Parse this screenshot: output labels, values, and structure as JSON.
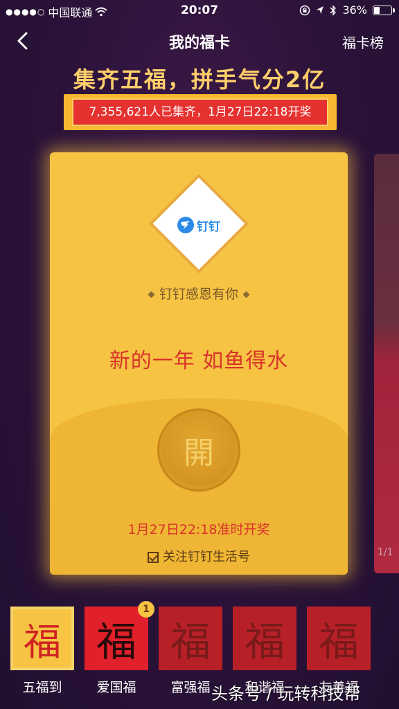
{
  "status_bar": {
    "carrier": "中国联通",
    "time": "20:07",
    "battery": "36%",
    "battery_level": 0.36
  },
  "nav": {
    "title": "我的福卡",
    "right_link": "福卡榜"
  },
  "headline": "集齐五福，拼手气分2亿",
  "banner": "7,355,621人已集齐，1月27日22:18开奖",
  "card": {
    "sponsor_logo_text": "钉钉",
    "sponsor_line": "钉钉感恩有你",
    "blessing": "新的一年 如鱼得水",
    "open_char": "開",
    "draw_time": "1月27日22:18准时开奖",
    "follow_label": "关注钉钉生活号"
  },
  "page_indicator": "1/1",
  "tabs": [
    {
      "label": "五福到",
      "glyph": "福",
      "active": true
    },
    {
      "label": "爱国福",
      "glyph": "福",
      "badge": "1"
    },
    {
      "label": "富强福",
      "glyph": "福"
    },
    {
      "label": "和谐福",
      "glyph": "福"
    },
    {
      "label": "友善福",
      "glyph": "福"
    }
  ],
  "watermark": "头条号 / 玩转科技帮",
  "colors": {
    "background": "#2a1238",
    "card": "#f6c343",
    "accent_red": "#e0202a",
    "headline_gold": "#ffcf6b"
  }
}
